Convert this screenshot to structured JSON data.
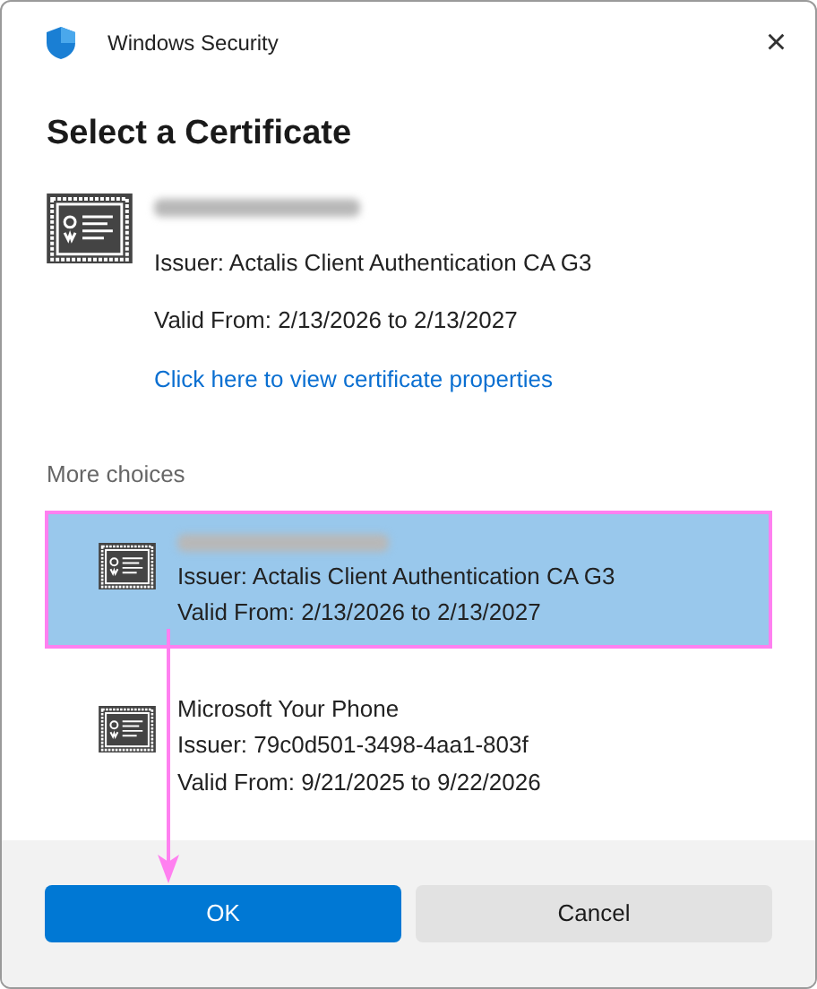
{
  "window": {
    "title": "Windows Security",
    "close": "×"
  },
  "heading": "Select a Certificate",
  "certificate": {
    "redacted": true,
    "issuer": "Issuer: Actalis Client Authentication CA G3",
    "valid": "Valid From: 2/13/2026 to 2/13/2027",
    "link": "Click here to view certificate properties"
  },
  "more_choices": {
    "label": "More choices",
    "items": [
      {
        "redacted": true,
        "issuer": "Issuer: Actalis Client Authentication CA G3",
        "valid": "Valid From: 2/13/2026 to 2/13/2027",
        "selected": true,
        "highlighted": true
      },
      {
        "redacted": false,
        "name": "Microsoft Your Phone",
        "issuer": "Issuer: 79c0d501-3498-4aa1-803f",
        "valid": "Valid From: 9/21/2025 to 9/22/2026",
        "selected": false,
        "highlighted": false
      }
    ]
  },
  "annotation": {
    "arrow_to_ok": true
  },
  "buttons": [
    {
      "label": "OK",
      "kind": "primary"
    },
    {
      "label": "Cancel",
      "kind": "secondary"
    }
  ]
}
